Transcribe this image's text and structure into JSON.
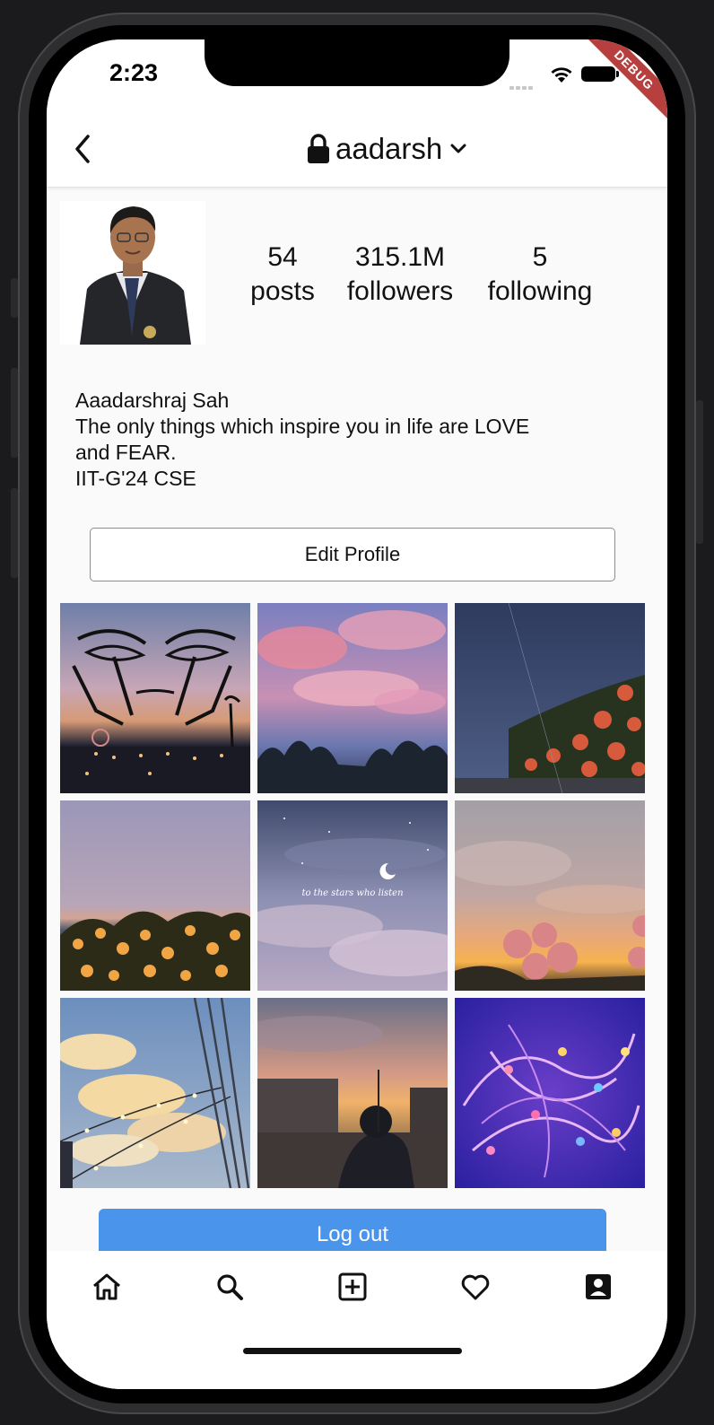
{
  "status_bar": {
    "time": "2:23",
    "debug_banner": "DEBUG"
  },
  "app_bar": {
    "username": "aadarsh",
    "icons": [
      "back-arrow-icon",
      "lock-icon",
      "chevron-down-icon"
    ]
  },
  "profile": {
    "stats": [
      {
        "count": "54",
        "label": "posts"
      },
      {
        "count": "315.1M",
        "label": "followers"
      },
      {
        "count": "5",
        "label": "following"
      }
    ],
    "bio": {
      "name": "Aaadarshraj Sah",
      "line1": "The only things which inspire you in life are LOVE",
      "line2": "and FEAR.",
      "line3": "IIT-G'24 CSE"
    },
    "edit_button": "Edit Profile"
  },
  "posts": [
    {
      "name": "eyes-hands-drawing-night-pier"
    },
    {
      "name": "pink-clouds-sunset-trees"
    },
    {
      "name": "night-sky-red-roses"
    },
    {
      "name": "orange-flowers-dusk"
    },
    {
      "name": "to-the-stars-moon-clouds",
      "caption": "to the stars who listen"
    },
    {
      "name": "pink-roses-golden-sunset"
    },
    {
      "name": "string-lights-cloudy-sky"
    },
    {
      "name": "silhouette-street-sunset"
    },
    {
      "name": "purple-fairy-lights"
    }
  ],
  "logout_button": "Log out",
  "bottom_nav": {
    "items": [
      "home-icon",
      "search-icon",
      "add-post-icon",
      "heart-icon",
      "profile-icon"
    ]
  },
  "colors": {
    "accent_blue": "#4a94eb",
    "debug_red": "#b7403f",
    "background": "#fafafa"
  }
}
